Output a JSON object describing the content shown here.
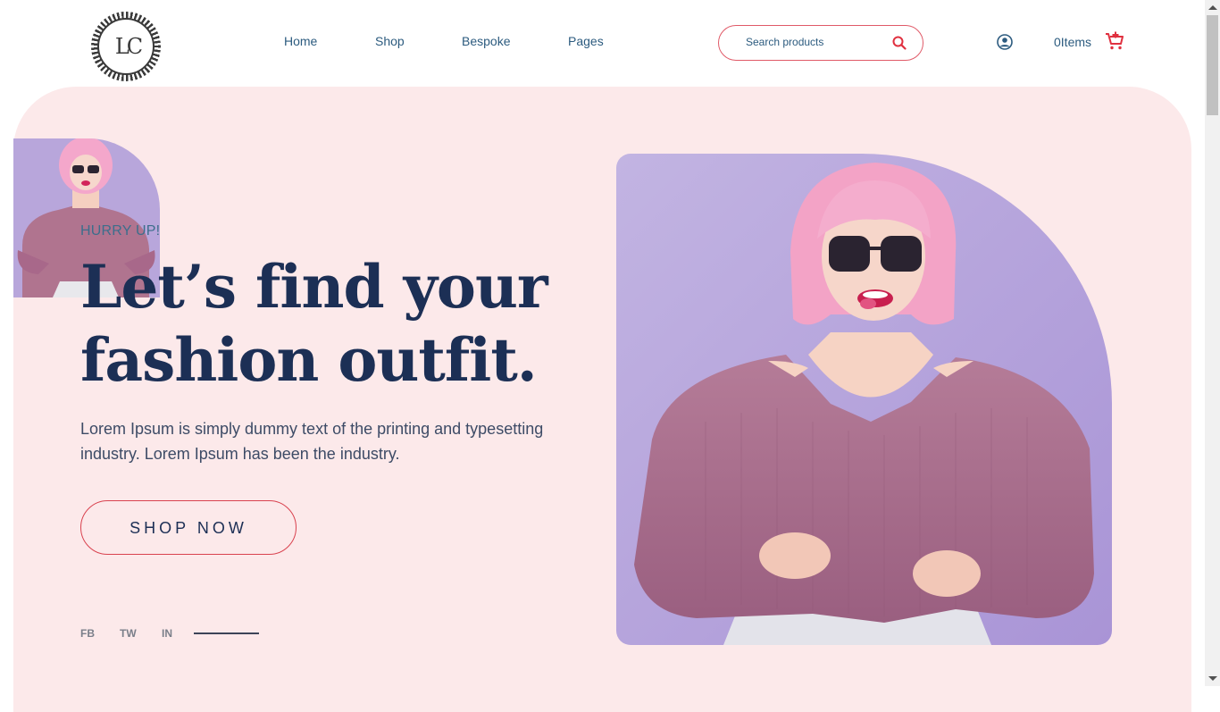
{
  "header": {
    "logo_text": "LC",
    "nav": [
      "Home",
      "Shop",
      "Bespoke",
      "Pages"
    ],
    "search_placeholder": "Search products",
    "cart_label": "0Items",
    "icons": {
      "search": "search-icon",
      "user": "user-circle-icon",
      "cart": "cart-add-icon"
    }
  },
  "hero": {
    "kicker": "HURRY UP!",
    "title_line1": "Let’s find your",
    "title_line2": "fashion outfit.",
    "description": "Lorem Ipsum is simply dummy text of the printing and typesetting industry. Lorem Ipsum has been the industry.",
    "cta_label": "SHOP NOW",
    "social": [
      "FB",
      "TW",
      "IN"
    ]
  },
  "colors": {
    "hero_bg": "#fce9ea",
    "accent": "#e05a68",
    "heading": "#1c2f55",
    "nav": "#2c5b7f",
    "photo_bg": "#b8a6db"
  }
}
